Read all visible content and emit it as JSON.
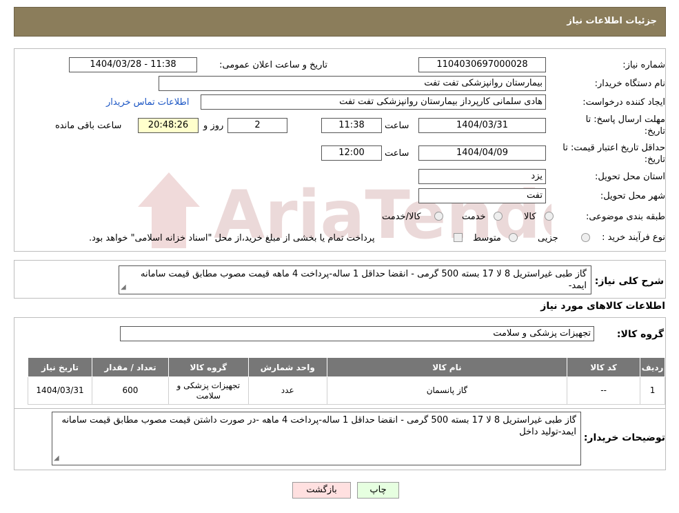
{
  "header": {
    "title": "جزئیات اطلاعات نیاز"
  },
  "form": {
    "need_number_label": "شماره نیاز:",
    "need_number": "1104030697000028",
    "announce_label": "تاریخ و ساعت اعلان عمومی:",
    "announce_value": "1404/03/28 - 11:38",
    "buyer_org_label": "نام دستگاه خریدار:",
    "buyer_org": "بیمارستان روانپزشکی تفت تفت",
    "creator_label": "ایجاد کننده درخواست:",
    "creator": "هادی سلمانی کارپرداز بیمارستان روانپزشکی تفت تفت",
    "contact_link": "اطلاعات تماس خریدار",
    "deadline_label_1": "مهلت ارسال پاسخ: تا",
    "deadline_label_2": "تاریخ:",
    "deadline_date": "1404/03/31",
    "hour_label": "ساعت",
    "deadline_time": "11:38",
    "days_value": "2",
    "days_label": "روز و",
    "remaining_time": "20:48:26",
    "remaining_label": "ساعت باقی مانده",
    "validity_label_1": "حداقل تاریخ اعتبار قیمت: تا",
    "validity_label_2": "تاریخ:",
    "validity_date": "1404/04/09",
    "validity_time": "12:00",
    "province_label": "استان محل تحویل:",
    "province": "یزد",
    "city_label": "شهر محل تحویل:",
    "city": "تفت",
    "category_label": "طبقه بندی موضوعی:",
    "category_options": [
      "کالا",
      "خدمت",
      "کالا/خدمت"
    ],
    "process_label": "نوع فرآیند خرید :",
    "process_options": [
      "جزیی",
      "متوسط"
    ],
    "process_note": "پرداخت تمام یا بخشی از مبلغ خرید،از محل \"اسناد خزانه اسلامی\" خواهد بود."
  },
  "summary": {
    "label": "شرح کلی نیاز:",
    "text": "گاز طبی غیراستریل 8 لا 17 بسته 500 گرمی - انقضا حداقل 1 ساله-پرداخت 4 ماهه  قیمت مصوب مطابق قیمت سامانه ایمد-"
  },
  "goods": {
    "section_title": "اطلاعات کالاهای مورد نیاز",
    "group_label": "گروه کالا:",
    "group_value": "تجهیزات پزشکی و سلامت",
    "columns": [
      "ردیف",
      "کد کالا",
      "نام کالا",
      "واحد شمارش",
      "گروه کالا",
      "تعداد / مقدار",
      "تاریخ نیاز"
    ],
    "rows": [
      {
        "row": "1",
        "code": "--",
        "name": "گاز پانسمان",
        "unit": "عدد",
        "group": "تجهیزات پزشکی و سلامت",
        "qty": "600",
        "date": "1404/03/31"
      }
    ]
  },
  "buyer_notes": {
    "label": "توضیحات خریدار:",
    "text": "گاز طبی غیراستریل 8 لا 17 بسته 500 گرمی - انقضا حداقل 1 ساله-پرداخت 4 ماهه -در صورت داشتن قیمت مصوب مطابق قیمت سامانه ایمد-تولید داخل"
  },
  "buttons": {
    "print": "چاپ",
    "back": "بازگشت"
  },
  "watermark": {
    "text": "AriaTender.neT"
  },
  "colors": {
    "header": "#8b7d5b",
    "back_button": "#ffe0e0",
    "print_button": "#e6ffe0",
    "link": "#1a55c4"
  }
}
